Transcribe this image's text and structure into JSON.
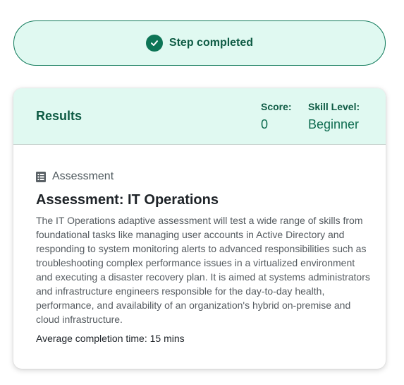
{
  "banner": {
    "text": "Step completed",
    "icon": "check-circle-icon",
    "accent": "#0d7556",
    "background": "#e0f9f1"
  },
  "results": {
    "title": "Results",
    "score_label": "Score:",
    "score_value": "0",
    "skill_label": "Skill Level:",
    "skill_value": "Beginner"
  },
  "assessment": {
    "type_icon": "list-icon",
    "type_label": "Assessment",
    "title": "Assessment: IT Operations",
    "description": "The IT Operations adaptive assessment will test a wide range of skills from foundational tasks like managing user accounts in Active Directory and responding to system monitoring alerts to advanced responsibilities such as troubleshooting complex performance issues in a virtualized environment and executing a disaster recovery plan. It is aimed at systems administrators and infrastructure engineers responsible for the day-to-day health, performance, and availability of an organization's hybrid on-premise and cloud infrastructure.",
    "avg_time": "Average completion time: 15 mins"
  }
}
